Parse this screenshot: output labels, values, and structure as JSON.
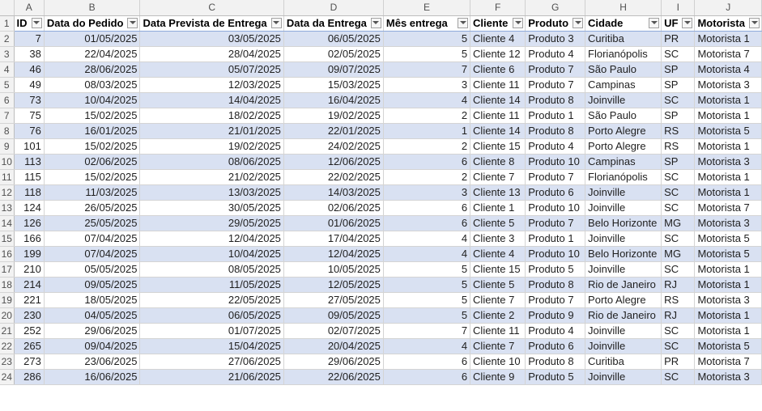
{
  "columns": [
    "A",
    "B",
    "C",
    "D",
    "E",
    "F",
    "G",
    "H",
    "I",
    "J"
  ],
  "headers": [
    "ID",
    "Data do Pedido",
    "Data Prevista de Entrega",
    "Data da Entrega",
    "Mês entrega",
    "Cliente",
    "Produto",
    "Cidade",
    "UF",
    "Motorista"
  ],
  "rows": [
    [
      "7",
      "01/05/2025",
      "03/05/2025",
      "06/05/2025",
      "5",
      "Cliente 4",
      "Produto 3",
      "Curitiba",
      "PR",
      "Motorista 1"
    ],
    [
      "38",
      "22/04/2025",
      "28/04/2025",
      "02/05/2025",
      "5",
      "Cliente 12",
      "Produto 4",
      "Florianópolis",
      "SC",
      "Motorista 7"
    ],
    [
      "46",
      "28/06/2025",
      "05/07/2025",
      "09/07/2025",
      "7",
      "Cliente 6",
      "Produto 7",
      "São Paulo",
      "SP",
      "Motorista 4"
    ],
    [
      "49",
      "08/03/2025",
      "12/03/2025",
      "15/03/2025",
      "3",
      "Cliente 11",
      "Produto 7",
      "Campinas",
      "SP",
      "Motorista 3"
    ],
    [
      "73",
      "10/04/2025",
      "14/04/2025",
      "16/04/2025",
      "4",
      "Cliente 14",
      "Produto 8",
      "Joinville",
      "SC",
      "Motorista 1"
    ],
    [
      "75",
      "15/02/2025",
      "18/02/2025",
      "19/02/2025",
      "2",
      "Cliente 11",
      "Produto 1",
      "São Paulo",
      "SP",
      "Motorista 1"
    ],
    [
      "76",
      "16/01/2025",
      "21/01/2025",
      "22/01/2025",
      "1",
      "Cliente 14",
      "Produto 8",
      "Porto Alegre",
      "RS",
      "Motorista 5"
    ],
    [
      "101",
      "15/02/2025",
      "19/02/2025",
      "24/02/2025",
      "2",
      "Cliente 15",
      "Produto 4",
      "Porto Alegre",
      "RS",
      "Motorista 1"
    ],
    [
      "113",
      "02/06/2025",
      "08/06/2025",
      "12/06/2025",
      "6",
      "Cliente 8",
      "Produto 10",
      "Campinas",
      "SP",
      "Motorista 3"
    ],
    [
      "115",
      "15/02/2025",
      "21/02/2025",
      "22/02/2025",
      "2",
      "Cliente 7",
      "Produto 7",
      "Florianópolis",
      "SC",
      "Motorista 1"
    ],
    [
      "118",
      "11/03/2025",
      "13/03/2025",
      "14/03/2025",
      "3",
      "Cliente 13",
      "Produto 6",
      "Joinville",
      "SC",
      "Motorista 1"
    ],
    [
      "124",
      "26/05/2025",
      "30/05/2025",
      "02/06/2025",
      "6",
      "Cliente 1",
      "Produto 10",
      "Joinville",
      "SC",
      "Motorista 7"
    ],
    [
      "126",
      "25/05/2025",
      "29/05/2025",
      "01/06/2025",
      "6",
      "Cliente 5",
      "Produto 7",
      "Belo Horizonte",
      "MG",
      "Motorista 3"
    ],
    [
      "166",
      "07/04/2025",
      "12/04/2025",
      "17/04/2025",
      "4",
      "Cliente 3",
      "Produto 1",
      "Joinville",
      "SC",
      "Motorista 5"
    ],
    [
      "199",
      "07/04/2025",
      "10/04/2025",
      "12/04/2025",
      "4",
      "Cliente 4",
      "Produto 10",
      "Belo Horizonte",
      "MG",
      "Motorista 5"
    ],
    [
      "210",
      "05/05/2025",
      "08/05/2025",
      "10/05/2025",
      "5",
      "Cliente 15",
      "Produto 5",
      "Joinville",
      "SC",
      "Motorista 1"
    ],
    [
      "214",
      "09/05/2025",
      "11/05/2025",
      "12/05/2025",
      "5",
      "Cliente 5",
      "Produto 8",
      "Rio de Janeiro",
      "RJ",
      "Motorista 1"
    ],
    [
      "221",
      "18/05/2025",
      "22/05/2025",
      "27/05/2025",
      "5",
      "Cliente 7",
      "Produto 7",
      "Porto Alegre",
      "RS",
      "Motorista 3"
    ],
    [
      "230",
      "04/05/2025",
      "06/05/2025",
      "09/05/2025",
      "5",
      "Cliente 2",
      "Produto 9",
      "Rio de Janeiro",
      "RJ",
      "Motorista 1"
    ],
    [
      "252",
      "29/06/2025",
      "01/07/2025",
      "02/07/2025",
      "7",
      "Cliente 11",
      "Produto 4",
      "Joinville",
      "SC",
      "Motorista 1"
    ],
    [
      "265",
      "09/04/2025",
      "15/04/2025",
      "20/04/2025",
      "4",
      "Cliente 7",
      "Produto 6",
      "Joinville",
      "SC",
      "Motorista 5"
    ],
    [
      "273",
      "23/06/2025",
      "27/06/2025",
      "29/06/2025",
      "6",
      "Cliente 10",
      "Produto 8",
      "Curitiba",
      "PR",
      "Motorista 7"
    ],
    [
      "286",
      "16/06/2025",
      "21/06/2025",
      "22/06/2025",
      "6",
      "Cliente 9",
      "Produto 5",
      "Joinville",
      "SC",
      "Motorista 3"
    ]
  ],
  "row_numbers": [
    "1",
    "2",
    "3",
    "4",
    "5",
    "6",
    "7",
    "8",
    "9",
    "10",
    "11",
    "12",
    "13",
    "14",
    "15",
    "16",
    "17",
    "18",
    "19",
    "20",
    "21",
    "22",
    "23",
    "24"
  ]
}
